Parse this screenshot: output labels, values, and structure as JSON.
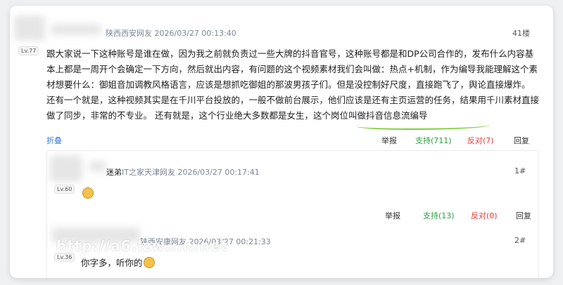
{
  "main_comment": {
    "user_info": "陕西西安网友 2026/03/27 00:13:40",
    "level": "Lv.77",
    "floor": "41楼",
    "content": "跟大家说一下这种账号是谁在做，因为我之前就负责过一些大牌的抖音官号，这种账号都是和DP公司合作的，发布什么内容基本上都是一周开个会确定一下方向，然后就出内容，有问题的这个视频素材我们会叫做：热点+机制，作为编导我能理解这个素材想要什么：御姐音加调教风格语言，应该是想抓吃御姐的那波男孩子们。但是没控制好尺度，直接跑飞了，舆论直接爆炸。 还有一个就是，这种视频其实是在千川平台投放的，一般不做前台展示，他们应该是还有主页运营的任务，结果用千川素材直接做了同步，非常的不专业。 还有就是，这个行业绝大多数都是女生，这个岗位叫做抖音信息流编导",
    "fold": "折叠",
    "actions": {
      "report": "举报",
      "support": "支持(711)",
      "oppose": "反对(7)",
      "reply": "回复"
    }
  },
  "reply1": {
    "name_tail": "迷弟",
    "user_info": "IT之家天津网友 2026/03/27 00:17:41",
    "level": "Lv.60",
    "floor": "1#",
    "emoji": "grin-emoji",
    "actions": {
      "report": "举报",
      "support": "支持(13)",
      "oppose": "反对(0)",
      "reply": "回复"
    }
  },
  "reply2": {
    "user_info": "陕西安康网友 2026/03/27 00:21:33",
    "level": "Lv.36",
    "floor": "2#",
    "content": "你字多，听你的",
    "emoji": "laugh-emoji"
  },
  "watermark": "http://a6.lzw...n.net"
}
